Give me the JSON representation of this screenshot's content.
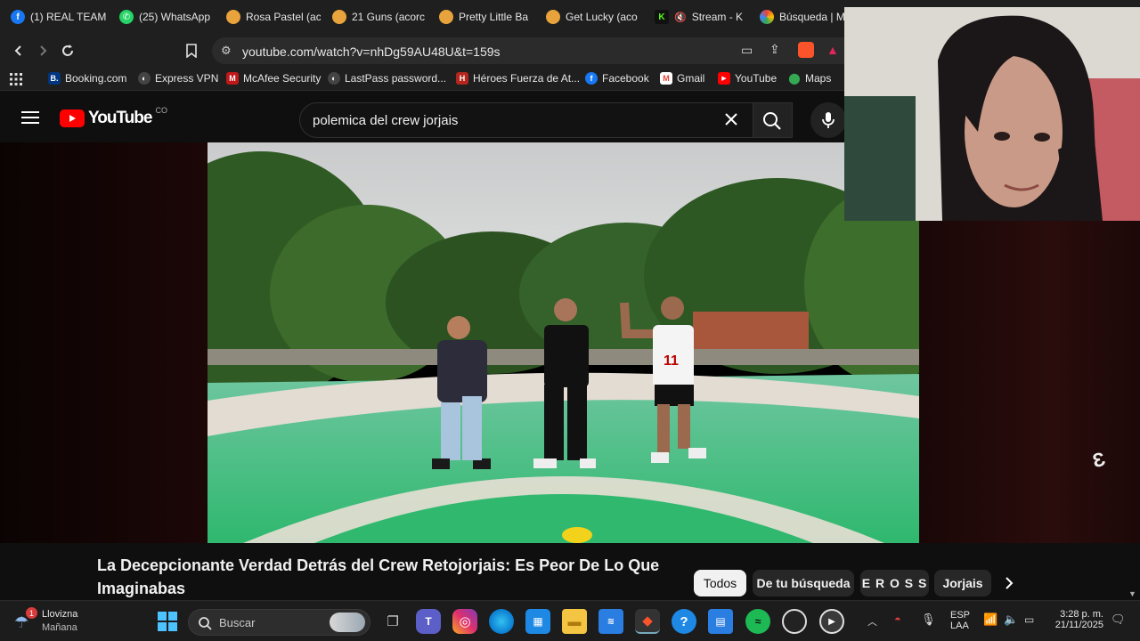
{
  "browser": {
    "tabs": [
      {
        "label": "(1) REAL TEAM",
        "icon": "facebook-icon",
        "color": "#1877f2"
      },
      {
        "label": "(25) WhatsApp",
        "icon": "whatsapp-icon",
        "color": "#25d366"
      },
      {
        "label": "Rosa Pastel (ac",
        "icon": "brave-shield-icon",
        "color": "#e8a33c"
      },
      {
        "label": "21 Guns (acorc",
        "icon": "brave-shield-icon",
        "color": "#e8a33c"
      },
      {
        "label": "Pretty Little Ba",
        "icon": "brave-shield-icon",
        "color": "#e8a33c"
      },
      {
        "label": "Get Lucky (aco",
        "icon": "brave-shield-icon",
        "color": "#e8a33c"
      },
      {
        "label": "Stream - K",
        "icon": "kick-icon",
        "color": "#53fc18"
      },
      {
        "label": "Búsqueda | M",
        "icon": "search-tab-icon",
        "color": "#7b61ff"
      }
    ],
    "url": "youtube.com/watch?v=nhDg59AU48U&t=159s",
    "bookmarks": [
      {
        "label": "Booking.com",
        "color": "#003580",
        "glyph": "B."
      },
      {
        "label": "Express VPN",
        "color": "#333333",
        "glyph": "◐"
      },
      {
        "label": "McAfee Security",
        "color": "#c01818",
        "glyph": "M"
      },
      {
        "label": "LastPass password...",
        "color": "#333333",
        "glyph": "◐"
      },
      {
        "label": "Héroes Fuerza de At...",
        "color": "#b3261e",
        "glyph": "H"
      },
      {
        "label": "Facebook",
        "color": "#1877f2",
        "glyph": "f"
      },
      {
        "label": "Gmail",
        "color": "#ea4335",
        "glyph": "M"
      },
      {
        "label": "YouTube",
        "color": "#ff0000",
        "glyph": "▶"
      },
      {
        "label": "Maps",
        "color": "#34a853",
        "glyph": "⬤"
      }
    ]
  },
  "youtube": {
    "logo_text": "YouTube",
    "country_code": "CO",
    "search_value": "polemica del crew jorjais",
    "video_title": "La Decepcionante Verdad Detrás del Crew Retojorjais: Es Peor De Lo Que Imaginabas",
    "chips": [
      "Todos",
      "De tu búsqueda",
      "E R O S S",
      "Jorjais"
    ],
    "active_chip": "Todos"
  },
  "taskbar": {
    "weather_badge": "1",
    "weather_line1": "Llovizna",
    "weather_line2": "Mañana",
    "search_placeholder": "Buscar",
    "lang_line1": "ESP",
    "lang_line2": "LAA",
    "time": "3:28 p. m.",
    "date": "21/11/2025"
  }
}
